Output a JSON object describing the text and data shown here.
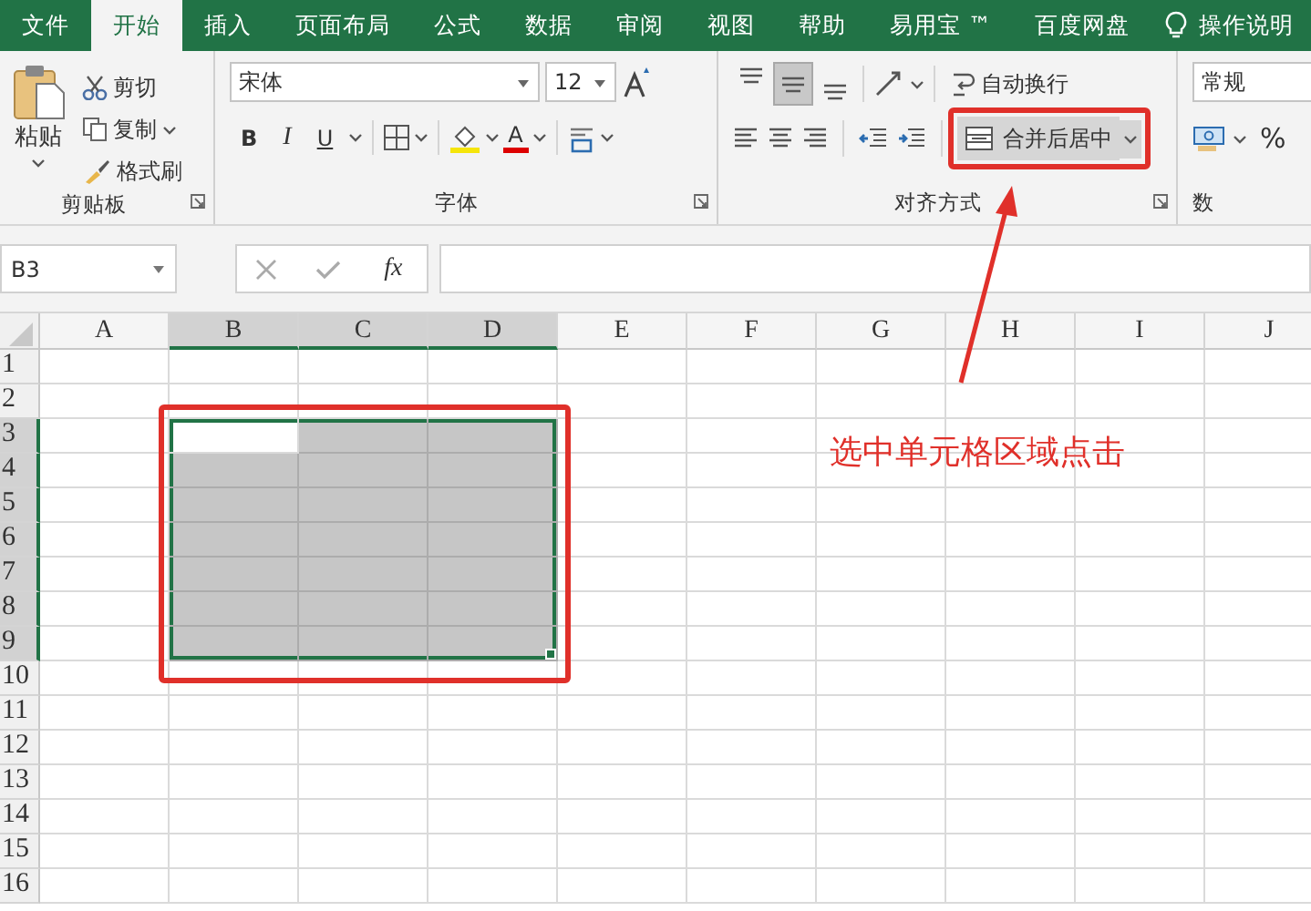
{
  "tabs": [
    {
      "label": "文件",
      "selected": false
    },
    {
      "label": "开始",
      "selected": true
    },
    {
      "label": "插入",
      "selected": false
    },
    {
      "label": "页面布局",
      "selected": false
    },
    {
      "label": "公式",
      "selected": false
    },
    {
      "label": "数据",
      "selected": false
    },
    {
      "label": "审阅",
      "selected": false
    },
    {
      "label": "视图",
      "selected": false
    },
    {
      "label": "帮助",
      "selected": false
    },
    {
      "label": "易用宝 ™",
      "selected": false
    },
    {
      "label": "百度网盘",
      "selected": false
    }
  ],
  "tell_me": "操作说明",
  "clipboard": {
    "paste": "粘贴",
    "cut": "剪切",
    "copy": "复制",
    "format_painter": "格式刷",
    "group_label": "剪贴板"
  },
  "font": {
    "name": "宋体",
    "size": "12",
    "bold": "B",
    "italic": "I",
    "underline": "U",
    "font_color": "A",
    "group_label": "字体"
  },
  "alignment": {
    "vertical": [
      {
        "selected": false
      },
      {
        "selected": true
      },
      {
        "selected": false
      }
    ],
    "wrap": "自动换行",
    "merge": "合并后居中",
    "group_label": "对齐方式"
  },
  "number": {
    "format": "常规",
    "percent": "%",
    "group_label": "数"
  },
  "formula_bar": {
    "name_box": "B3",
    "function": "fx"
  },
  "sheet": {
    "columns": [
      {
        "label": "A",
        "selected": false
      },
      {
        "label": "B",
        "selected": true
      },
      {
        "label": "C",
        "selected": true
      },
      {
        "label": "D",
        "selected": true
      },
      {
        "label": "E",
        "selected": false
      },
      {
        "label": "F",
        "selected": false
      },
      {
        "label": "G",
        "selected": false
      },
      {
        "label": "H",
        "selected": false
      },
      {
        "label": "I",
        "selected": false
      },
      {
        "label": "J",
        "selected": false
      }
    ],
    "rows": [
      {
        "label": "1",
        "selected": false
      },
      {
        "label": "2",
        "selected": false
      },
      {
        "label": "3",
        "selected": true
      },
      {
        "label": "4",
        "selected": true
      },
      {
        "label": "5",
        "selected": true
      },
      {
        "label": "6",
        "selected": true
      },
      {
        "label": "7",
        "selected": true
      },
      {
        "label": "8",
        "selected": true
      },
      {
        "label": "9",
        "selected": true
      },
      {
        "label": "10",
        "selected": false
      },
      {
        "label": "11",
        "selected": false
      },
      {
        "label": "12",
        "selected": false
      },
      {
        "label": "13",
        "selected": false
      },
      {
        "label": "14",
        "selected": false
      },
      {
        "label": "15",
        "selected": false
      },
      {
        "label": "16",
        "selected": false
      }
    ]
  },
  "annotation": {
    "text": "选中单元格区域点击"
  }
}
